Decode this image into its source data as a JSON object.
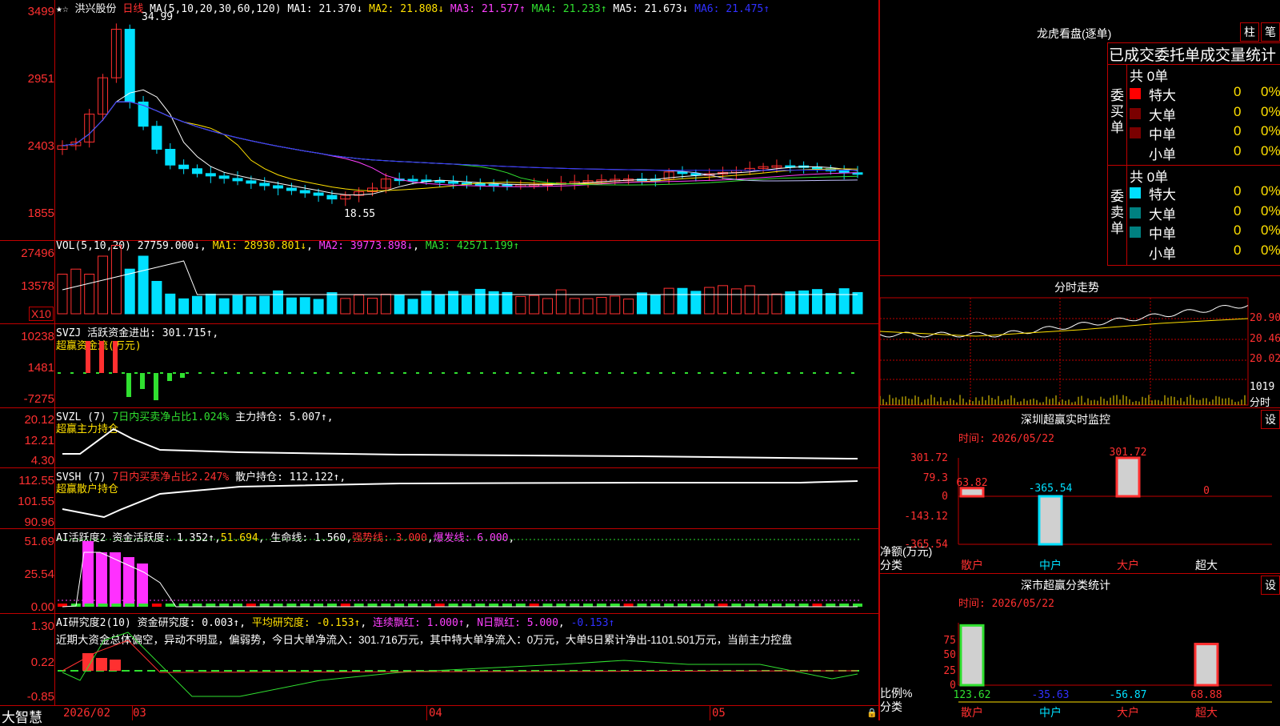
{
  "stock": {
    "name": "洪兴股份",
    "period": "日线"
  },
  "ma_line": {
    "label": "MA(5,10,20,30,60,120)",
    "ma1": "MA1: 21.370↓",
    "ma2": "MA2: 21.808↓",
    "ma3": "MA3: 21.577↑",
    "ma4": "MA4: 21.233↑",
    "ma5": "MA5: 21.673↓",
    "ma6": "MA6: 21.475↑"
  },
  "price_axis": [
    "3499",
    "2951",
    "2403",
    "1855"
  ],
  "price_marks": {
    "high": "34.99",
    "low": "18.55"
  },
  "vol_line": {
    "label": "VOL(5,10,20)",
    "value": "27759.000↓",
    "ma1": "MA1: 28930.801↓",
    "ma2": "MA2: 39773.898↓",
    "ma3": "MA3: 42571.199↑"
  },
  "vol_axis": [
    "27496",
    "13578"
  ],
  "vol_unit": "X10",
  "svzj": {
    "label": "SVZJ",
    "text": "活跃资金进出: 301.715↑,",
    "sub": "超赢资金流(万元)",
    "axis": [
      "10238",
      "1481",
      "-7275"
    ]
  },
  "svzl": {
    "label": "SVZL (7)",
    "ratio": "7日内买卖净占比1.024%",
    "text": "主力持仓: 5.007↑,",
    "sub": "超赢主力持仓",
    "axis": [
      "20.12",
      "12.21",
      "4.30"
    ]
  },
  "svsh": {
    "label": "SVSH (7)",
    "ratio": "7日内买卖净占比2.247%",
    "text": "散户持仓: 112.122↑,",
    "sub": "超赢散户持仓",
    "axis": [
      "112.55",
      "101.55",
      "90.96"
    ]
  },
  "ai2": {
    "label": "AI活跃度2",
    "a": "资金活跃度: 1.352↑",
    "b": "51.694",
    "c": "生命线: 1.560",
    "d": "强势线: 3.000",
    "e": "爆发线: 6.000",
    "axis": [
      "51.69",
      "25.54",
      "0.00"
    ]
  },
  "air": {
    "label": "AI研究度2(10)",
    "a": "资金研究度: 0.003↑",
    "b": "平均研究度: -0.153↑",
    "c": "连续飘红: 1.000↑",
    "d": "N日飘红: 5.000",
    "e": "-0.153↑",
    "axis": [
      "1.30",
      "0.22",
      "-0.85"
    ],
    "comment": "近期大资金总体偏空，异动不明显，偏弱势，今日大单净流入：301.716万元，其中特大单净流入：0万元，大单5日累计净出-1101.501万元，当前主力控盘"
  },
  "xaxis": {
    "brand": "大智慧",
    "labels": [
      "2026/02",
      "03",
      "04",
      "05"
    ]
  },
  "dragon": {
    "title": "龙虎看盘(逐单)",
    "btn1": "柱",
    "btn2": "笔",
    "header": "已成交委托单成交量统计",
    "buy": {
      "side": "委买单",
      "total": "共 0单",
      "rows": [
        {
          "name": "特大",
          "v": "0",
          "p": "0%"
        },
        {
          "name": "大单",
          "v": "0",
          "p": "0%"
        },
        {
          "name": "中单",
          "v": "0",
          "p": "0%"
        },
        {
          "name": "小单",
          "v": "0",
          "p": "0%"
        }
      ]
    },
    "sell": {
      "side": "委卖单",
      "total": "共 0单",
      "rows": [
        {
          "name": "特大",
          "v": "0",
          "p": "0%"
        },
        {
          "name": "大单",
          "v": "0",
          "p": "0%"
        },
        {
          "name": "中单",
          "v": "0",
          "p": "0%"
        },
        {
          "name": "小单",
          "v": "0",
          "p": "0%"
        }
      ]
    }
  },
  "intraday": {
    "title": "分时走势",
    "axis": [
      "20.90",
      "20.46",
      "20.02"
    ],
    "vol": "1019",
    "vol_label": "分时"
  },
  "monitor": {
    "title": "深圳超赢实时监控",
    "btn": "设",
    "time": "时间: 2026/05/22",
    "axis": [
      "301.72",
      "79.3",
      "0",
      "-143.12",
      "-365.54"
    ],
    "ylabel": "净额(万元)",
    "xlabel": "分类",
    "cats": [
      "散户",
      "中户",
      "大户",
      "超大"
    ],
    "values": [
      63.82,
      -365.54,
      301.72,
      0
    ],
    "value_labels": [
      "63.82",
      "-365.54",
      "301.72",
      "0"
    ]
  },
  "classify": {
    "title": "深市超赢分类统计",
    "btn": "设",
    "time": "时间: 2026/05/22",
    "axis": [
      "75",
      "50",
      "25",
      "0"
    ],
    "ylabel": "比例%",
    "xlabel": "分类",
    "cats": [
      "散户",
      "中户",
      "大户",
      "超大"
    ],
    "values": [
      123.62,
      -35.63,
      -56.87,
      68.88
    ],
    "value_labels": [
      "123.62",
      "-35.63",
      "-56.87",
      "68.88"
    ]
  },
  "colors": {
    "up": "#ff3030",
    "down": "#00e0ff",
    "grid": "#c00000"
  }
}
